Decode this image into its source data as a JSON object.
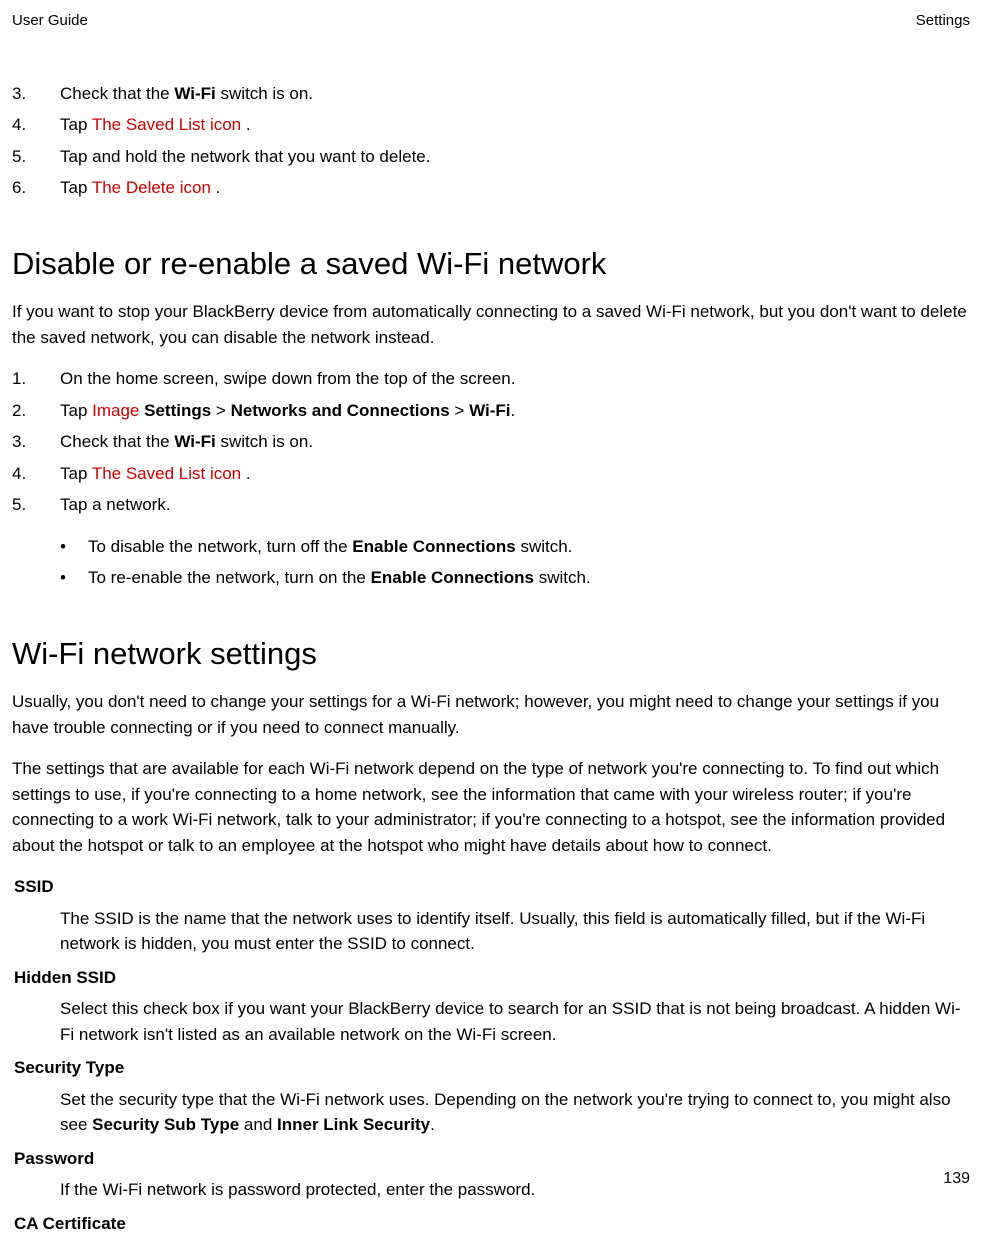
{
  "header": {
    "left": "User Guide",
    "right": "Settings"
  },
  "topList": [
    {
      "num": "3.",
      "parts": [
        {
          "t": "Check that the "
        },
        {
          "t": "Wi-Fi",
          "bold": true
        },
        {
          "t": " switch is on."
        }
      ]
    },
    {
      "num": "4.",
      "parts": [
        {
          "t": "Tap  "
        },
        {
          "t": "The Saved List icon",
          "img": true
        },
        {
          "t": " ."
        }
      ]
    },
    {
      "num": "5.",
      "parts": [
        {
          "t": "Tap and hold the network that you want to delete."
        }
      ]
    },
    {
      "num": "6.",
      "parts": [
        {
          "t": "Tap  "
        },
        {
          "t": "The Delete icon",
          "img": true
        },
        {
          "t": " ."
        }
      ]
    }
  ],
  "section1": {
    "heading": "Disable or re-enable a saved Wi-Fi network",
    "intro": "If you want to stop your BlackBerry device from automatically connecting to a saved Wi-Fi network, but you don't want to delete the saved network, you can disable the network instead.",
    "list": [
      {
        "num": "1.",
        "parts": [
          {
            "t": "On the home screen, swipe down from the top of the screen."
          }
        ]
      },
      {
        "num": "2.",
        "parts": [
          {
            "t": "Tap  "
          },
          {
            "t": "Image",
            "img": true
          },
          {
            "t": "  "
          },
          {
            "t": "Settings",
            "bold": true
          },
          {
            "t": " > "
          },
          {
            "t": "Networks and Connections",
            "bold": true
          },
          {
            "t": " > "
          },
          {
            "t": "Wi-Fi",
            "bold": true
          },
          {
            "t": "."
          }
        ]
      },
      {
        "num": "3.",
        "parts": [
          {
            "t": "Check that the "
          },
          {
            "t": "Wi-Fi",
            "bold": true
          },
          {
            "t": " switch is on."
          }
        ]
      },
      {
        "num": "4.",
        "parts": [
          {
            "t": "Tap  "
          },
          {
            "t": "The Saved List icon",
            "img": true
          },
          {
            "t": " ."
          }
        ]
      },
      {
        "num": "5.",
        "parts": [
          {
            "t": "Tap a network."
          }
        ]
      }
    ],
    "bullets": [
      {
        "parts": [
          {
            "t": "To disable the network, turn off the "
          },
          {
            "t": "Enable Connections",
            "bold": true
          },
          {
            "t": " switch."
          }
        ]
      },
      {
        "parts": [
          {
            "t": "To re-enable the network, turn on the "
          },
          {
            "t": "Enable Connections",
            "bold": true
          },
          {
            "t": " switch."
          }
        ]
      }
    ]
  },
  "section2": {
    "heading": "Wi-Fi network settings",
    "paras": [
      "Usually, you don't need to change your settings for a Wi-Fi network; however, you might need to change your settings if you have trouble connecting or if you need to connect manually.",
      "The settings that are available for each Wi-Fi network depend on the type of network you're connecting to. To find out which settings to use, if you're connecting to a home network, see the information that came with your wireless router; if you're connecting to a work Wi-Fi network, talk to your administrator; if you're connecting to a hotspot, see the information provided about the hotspot or talk to an employee at the hotspot who might have details about how to connect."
    ],
    "defs": [
      {
        "term": "SSID",
        "def": [
          {
            "t": "The SSID is the name that the network uses to identify itself. Usually, this field is automatically filled, but if the Wi-Fi network is hidden, you must enter the SSID to connect."
          }
        ]
      },
      {
        "term": "Hidden SSID",
        "def": [
          {
            "t": "Select this check box if you want your BlackBerry device to search for an SSID that is not being broadcast. A hidden Wi-Fi network isn't listed as an available network on the Wi-Fi screen."
          }
        ]
      },
      {
        "term": "Security Type",
        "def": [
          {
            "t": "Set the security type that the Wi-Fi network uses. Depending on the network you're trying to connect to, you might also see "
          },
          {
            "t": "Security Sub Type",
            "bold": true
          },
          {
            "t": " and "
          },
          {
            "t": "Inner Link Security",
            "bold": true
          },
          {
            "t": "."
          }
        ]
      },
      {
        "term": "Password",
        "def": [
          {
            "t": "If the Wi-Fi network is password protected, enter the password."
          }
        ]
      },
      {
        "term": "CA Certificate",
        "def": []
      }
    ]
  },
  "pageNumber": "139"
}
